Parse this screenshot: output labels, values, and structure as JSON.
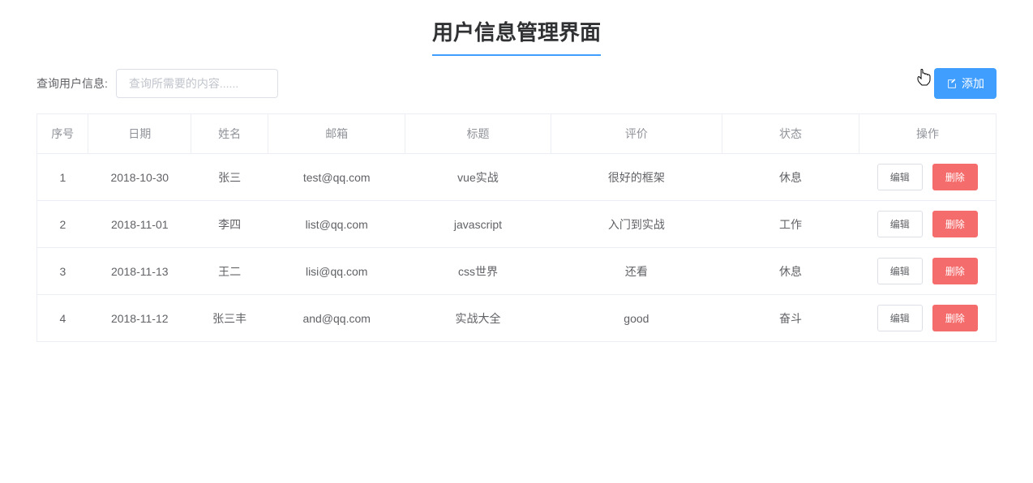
{
  "page": {
    "title": "用户信息管理界面"
  },
  "toolbar": {
    "search_label": "查询用户信息:",
    "search_placeholder": "查询所需要的内容......",
    "add_button_label": "添加"
  },
  "table": {
    "headers": {
      "index": "序号",
      "date": "日期",
      "name": "姓名",
      "email": "邮箱",
      "title": "标题",
      "review": "评价",
      "status": "状态",
      "action": "操作"
    },
    "actions": {
      "edit": "编辑",
      "delete": "删除"
    },
    "rows": [
      {
        "index": "1",
        "date": "2018-10-30",
        "name": "张三",
        "email": "test@qq.com",
        "title": "vue实战",
        "review": "很好的框架",
        "status": "休息"
      },
      {
        "index": "2",
        "date": "2018-11-01",
        "name": "李四",
        "email": "list@qq.com",
        "title": "javascript",
        "review": "入门到实战",
        "status": "工作"
      },
      {
        "index": "3",
        "date": "2018-11-13",
        "name": "王二",
        "email": "lisi@qq.com",
        "title": "css世界",
        "review": "还看",
        "status": "休息"
      },
      {
        "index": "4",
        "date": "2018-11-12",
        "name": "张三丰",
        "email": "and@qq.com",
        "title": "实战大全",
        "review": "good",
        "status": "奋斗"
      }
    ]
  }
}
